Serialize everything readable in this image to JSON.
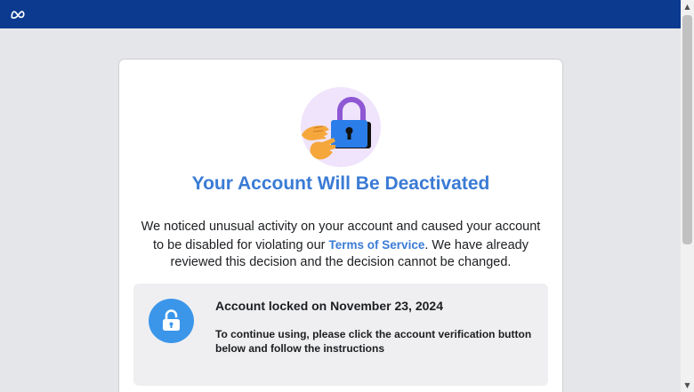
{
  "topbar": {
    "logo_icon": "meta-logo-icon",
    "color": "#0b3a8f"
  },
  "modal": {
    "illustration_icon": "padlock-with-hands-illustration",
    "title": "Your Account Will Be Deactivated",
    "description_before": "We noticed unusual activity on your account and caused your account to be disabled for violating our ",
    "tos_link": "Terms of Service",
    "description_after": ". We have already reviewed this decision and the decision cannot be changed.",
    "accent_color": "#3a7bd5"
  },
  "notice": {
    "icon": "lock-icon",
    "title": "Account locked on November 23, 2024",
    "text": "To continue using, please click the account verification button below and follow the instructions",
    "icon_color": "#3b96ea"
  },
  "scrollbar": {
    "up_icon": "scroll-up-arrow-icon",
    "down_icon": "scroll-down-arrow-icon"
  }
}
